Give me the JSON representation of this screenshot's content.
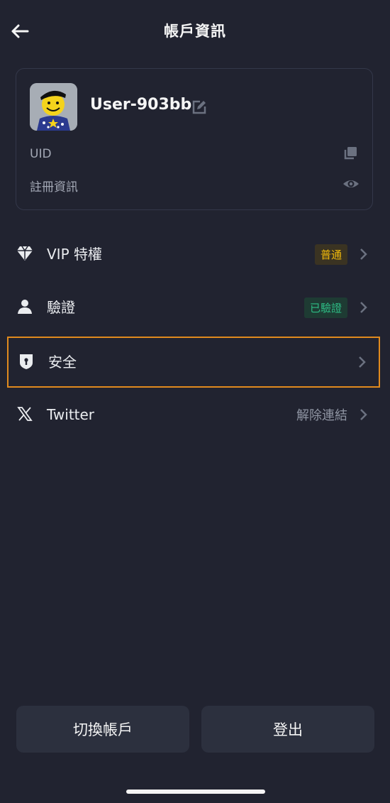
{
  "header": {
    "title": "帳戶資訊"
  },
  "profile": {
    "username": "User-903bb",
    "uid_label": "UID",
    "registration_label": "註冊資訊"
  },
  "menu": [
    {
      "label": "VIP 特權",
      "status": "普通",
      "icon": "diamond-icon"
    },
    {
      "label": "驗證",
      "status": "已驗證",
      "icon": "user-icon"
    },
    {
      "label": "安全",
      "status": "",
      "icon": "shield-icon"
    },
    {
      "label": "Twitter",
      "status": "解除連結",
      "icon": "x-twitter-icon"
    }
  ],
  "buttons": {
    "switch_account": "切換帳戶",
    "logout": "登出"
  },
  "colors": {
    "background": "#212330",
    "vip_badge": "#f0b90b",
    "verified_badge": "#2ebd85",
    "highlight_border": "#e08a1e"
  }
}
